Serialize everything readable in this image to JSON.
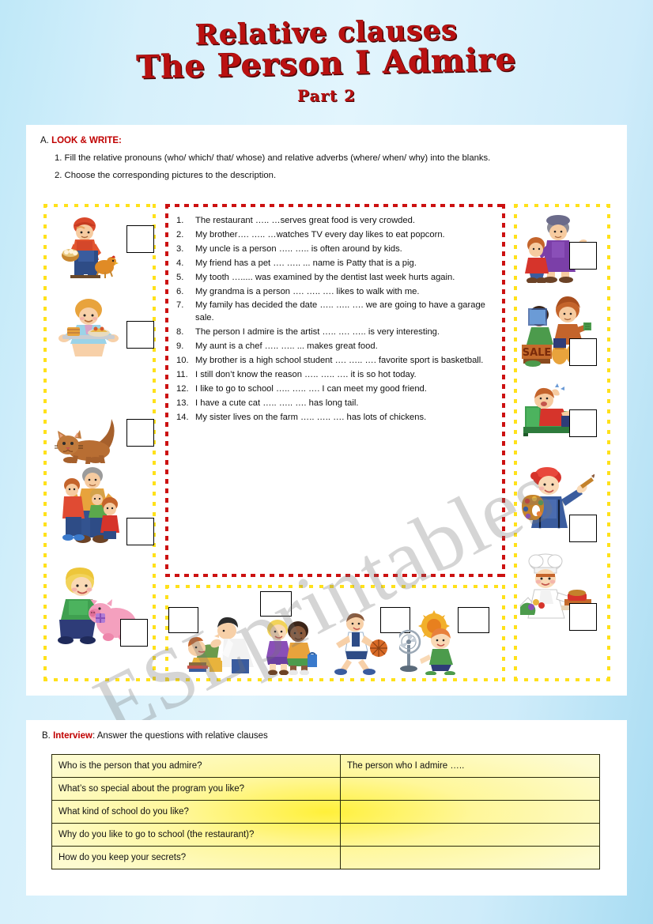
{
  "title": {
    "line1": "Relative clauses",
    "line2": "The Person I Admire",
    "line3": "Part 2",
    "color": "#BA1111"
  },
  "watermark": "ESLprintables.com",
  "colors": {
    "page_background": "#CCEEF8",
    "panel_border_blue": "#1F74BD",
    "picture_border_yellow": "#FFE11A",
    "sentence_border_red": "#CC1111",
    "heading_red": "#C00000",
    "table_yellow": "#FFF03A"
  },
  "section_a": {
    "letter": "A.",
    "heading": "LOOK & WRITE:",
    "instructions": [
      "1. Fill the relative pronouns (who/ which/ that/ whose) and relative adverbs (where/ when/ why) into the blanks.",
      "2. Choose the corresponding pictures to the description."
    ],
    "sentences": [
      {
        "num": "1.",
        "text": "The restaurant ….. …serves great food is very crowded."
      },
      {
        "num": "2.",
        "text": "My brother…. ….. …watches TV every day likes to eat popcorn."
      },
      {
        "num": "3.",
        "text": "My uncle is a person ….. ….. is often around by kids."
      },
      {
        "num": "4.",
        "text": "My friend has a pet …. ….. ... name is Patty that is a pig."
      },
      {
        "num": "5.",
        "text": "My tooth …..... was examined by the dentist last week hurts again."
      },
      {
        "num": "6.",
        "text": "My grandma is a person …. ….. …. likes to walk with me."
      },
      {
        "num": "7.",
        "text": "My family has decided the date ….. ….. …. we are going to have a garage sale."
      },
      {
        "num": "8.",
        "text": "The person I admire is the artist ….. …. ….. is very interesting."
      },
      {
        "num": "9.",
        "text": "My aunt is a chef ….. ….. ... makes great food."
      },
      {
        "num": "10.",
        "text": "My brother is a high school student …. ….. …. favorite sport is basketball."
      },
      {
        "num": "11.",
        "text": "I still don’t know the reason ….. ….. …. it is so hot today."
      },
      {
        "num": "12.",
        "text": "I like to go to school ….. ….. …. I can meet my good friend."
      },
      {
        "num": "13.",
        "text": "I have a cute cat ….. ….. …. has long tail."
      },
      {
        "num": "14.",
        "text": "My sister lives on the farm ….. ….. …. has lots of chickens."
      }
    ],
    "pictures_left": [
      {
        "name": "farmer-with-eggs-and-chicken"
      },
      {
        "name": "waitress-with-food-tray"
      },
      {
        "name": "brown-cat"
      },
      {
        "name": "uncle-with-children"
      },
      {
        "name": "girl-hugging-pig"
      }
    ],
    "pictures_right": [
      {
        "name": "grandma-walking-with-child"
      },
      {
        "name": "family-garage-sale"
      },
      {
        "name": "man-watching-tv-with-popcorn"
      },
      {
        "name": "artist-painting-with-palette"
      },
      {
        "name": "chef-cooking"
      }
    ],
    "pictures_bottom": [
      {
        "name": "dentist-examining-tooth"
      },
      {
        "name": "two-school-friends"
      },
      {
        "name": "basketball-player"
      },
      {
        "name": "girl-with-electric-fan-hot-day"
      }
    ]
  },
  "section_b": {
    "letter": "B.",
    "heading": "Interview",
    "instruction": ": Answer the questions with relative clauses",
    "rows": [
      {
        "question": "Who is the person that you admire?",
        "answer": "The person who I admire ….."
      },
      {
        "question": "What’s so special about the program you like?",
        "answer": ""
      },
      {
        "question": "What kind of school do you like?",
        "answer": ""
      },
      {
        "question": "Why do you like to go to school (the restaurant)?",
        "answer": ""
      },
      {
        "question": "How do you keep your secrets?",
        "answer": ""
      }
    ]
  }
}
